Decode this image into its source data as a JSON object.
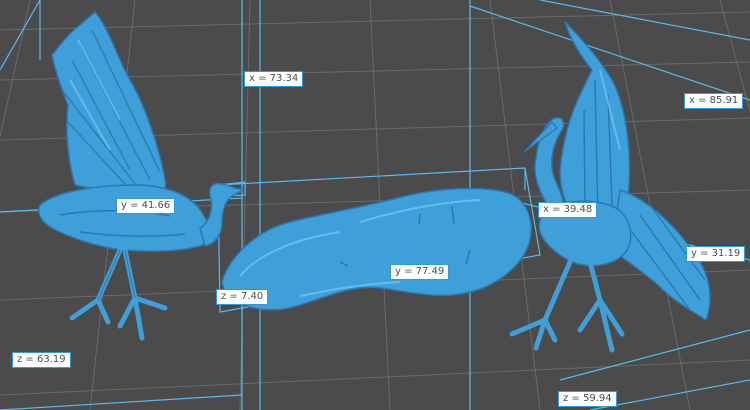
{
  "viewport": {
    "background": "#4b4b4b",
    "grid_color": "#6a6a6a",
    "bbox_color": "#59b9ee",
    "model_color": "#3f9fd8",
    "model_shadow": "#2a78ad",
    "model_highlight": "#7fd0fa"
  },
  "models": [
    {
      "name": "left-heron-model"
    },
    {
      "name": "rock-base-model"
    },
    {
      "name": "right-heron-model"
    }
  ],
  "dimension_labels": {
    "left_x": "x = 73.34",
    "left_y": "y = 41.66",
    "left_z": "z = 63.19",
    "mid_y": "y = 77.49",
    "mid_z": "z = 7.40",
    "right_x": "x = 39.48",
    "right_x2": "x = 85.91",
    "right_y": "y = 31.19",
    "right_z": "z = 59.94"
  }
}
